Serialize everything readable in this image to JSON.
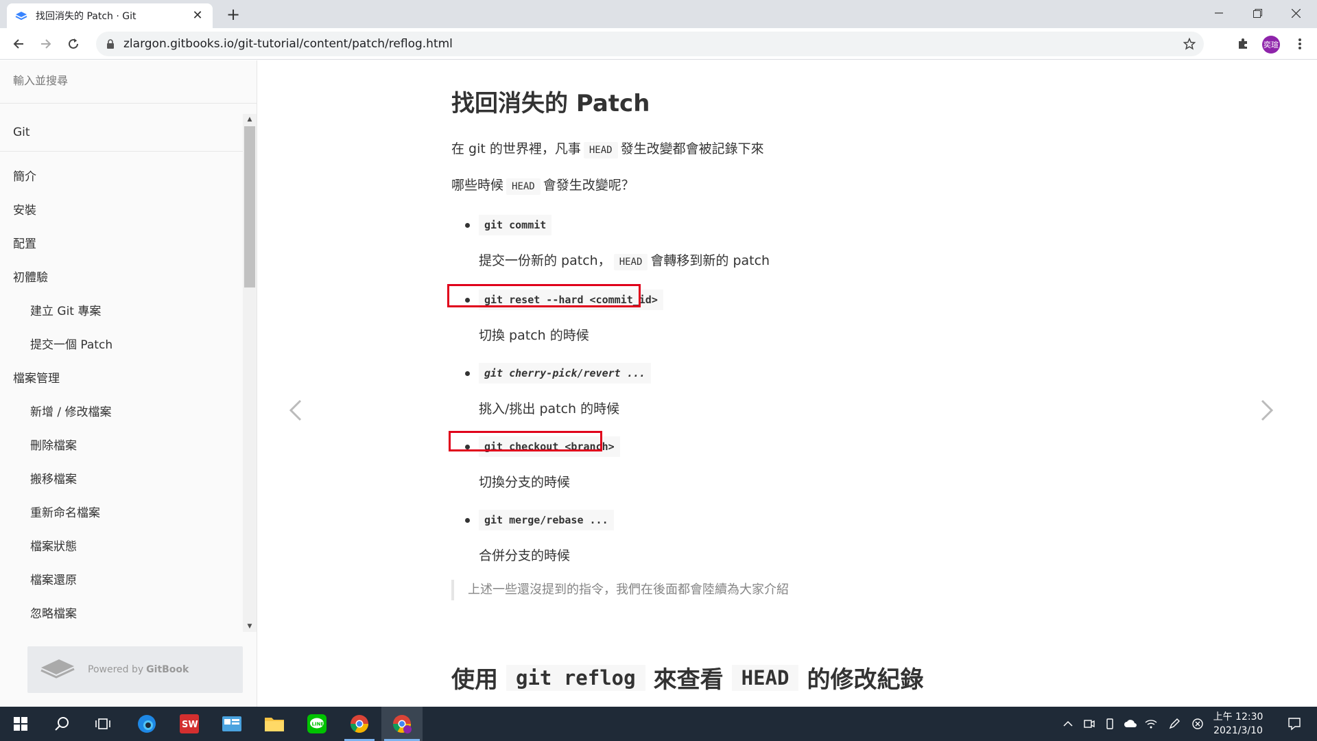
{
  "browser": {
    "tab_title": "找回消失的 Patch · Git",
    "url": "zlargon.gitbooks.io/git-tutorial/content/patch/reflog.html",
    "avatar_text": "奕瑄"
  },
  "sidebar": {
    "search_placeholder": "輸入並搜尋",
    "book_title": "Git",
    "items": [
      {
        "label": "簡介"
      },
      {
        "label": "安裝"
      },
      {
        "label": "配置"
      },
      {
        "label": "初體驗"
      },
      {
        "label": "建立 Git 專案"
      },
      {
        "label": "提交一個 Patch"
      },
      {
        "label": "檔案管理"
      },
      {
        "label": "新增 / 修改檔案"
      },
      {
        "label": "刪除檔案"
      },
      {
        "label": "搬移檔案"
      },
      {
        "label": "重新命名檔案"
      },
      {
        "label": "檔案狀態"
      },
      {
        "label": "檔案還原"
      },
      {
        "label": "忽略檔案"
      }
    ],
    "powered_by": "Powered by",
    "gitbook": "GitBook"
  },
  "content": {
    "title": "找回消失的 Patch",
    "intro1_a": "在 git 的世界裡，凡事",
    "intro1_code": "HEAD",
    "intro1_b": "發生改變都會被記錄下來",
    "intro2_a": "哪些時候",
    "intro2_code": "HEAD",
    "intro2_b": "會發生改變呢？",
    "commands": [
      {
        "cmd": "git commit",
        "desc_a": "提交一份新的 patch，",
        "desc_code": "HEAD",
        "desc_b": "會轉移到新的 patch"
      },
      {
        "cmd": "git reset --hard <commit_id>",
        "desc": "切換 patch 的時候"
      },
      {
        "cmd": "git cherry-pick/revert ...",
        "desc": "挑入/挑出 patch 的時候"
      },
      {
        "cmd": "git checkout <branch>",
        "desc": "切換分支的時候"
      },
      {
        "cmd": "git merge/rebase ...",
        "desc": "合併分支的時候"
      }
    ],
    "quote": "上述一些還沒提到的指令，我們在後面都會陸續為大家介紹",
    "h2_a": "使用",
    "h2_code1": "git reflog",
    "h2_b": "來查看",
    "h2_code2": "HEAD",
    "h2_c": "的修改紀錄"
  },
  "taskbar": {
    "time": "上午 12:30",
    "date": "2021/3/10"
  },
  "colors": {
    "highlight": "#e0001b",
    "avatar": "#8e24aa",
    "taskbar": "#1f2a37"
  }
}
